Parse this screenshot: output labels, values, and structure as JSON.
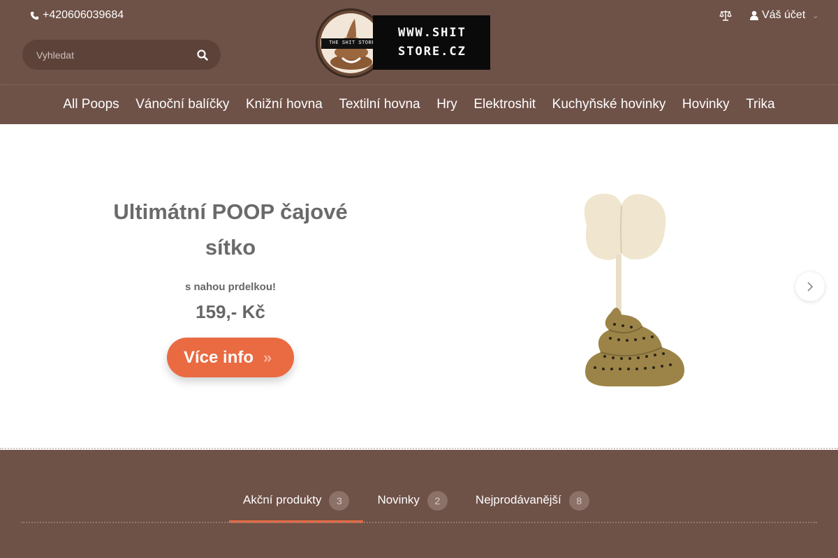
{
  "header": {
    "phone": "+420606039684",
    "search_placeholder": "Vyhledat",
    "logo": {
      "band_text": "THE SHIT STORE",
      "line1": "WWW.SHIT",
      "line2": "STORE.CZ"
    },
    "account_label": "Váš účet"
  },
  "nav": {
    "items": [
      {
        "label": "All Poops"
      },
      {
        "label": "Vánoční balíčky"
      },
      {
        "label": "Knižní hovna"
      },
      {
        "label": "Textilní hovna"
      },
      {
        "label": "Hry"
      },
      {
        "label": "Elektroshit"
      },
      {
        "label": "Kuchyňské hovinky"
      },
      {
        "label": "Hovinky"
      },
      {
        "label": "Trika"
      }
    ]
  },
  "hero": {
    "title": "Ultimátní POOP čajové sítko",
    "subtitle": "s nahou prdelkou!",
    "price": "159,- Kč",
    "cta_label": "Více info",
    "cta_arrows": "»"
  },
  "tabs": {
    "items": [
      {
        "label": "Akční produkty",
        "count": "3"
      },
      {
        "label": "Novinky",
        "count": "2"
      },
      {
        "label": "Nejprodávanější",
        "count": "8"
      }
    ]
  },
  "colors": {
    "header_bg": "#6e5147",
    "accent": "#ea6a42",
    "text_gray": "#6a6a6a"
  },
  "icons": {
    "phone": "phone-icon",
    "search": "search-icon",
    "compare": "scales-icon",
    "account": "user-icon",
    "next": "chevron-right-icon"
  }
}
